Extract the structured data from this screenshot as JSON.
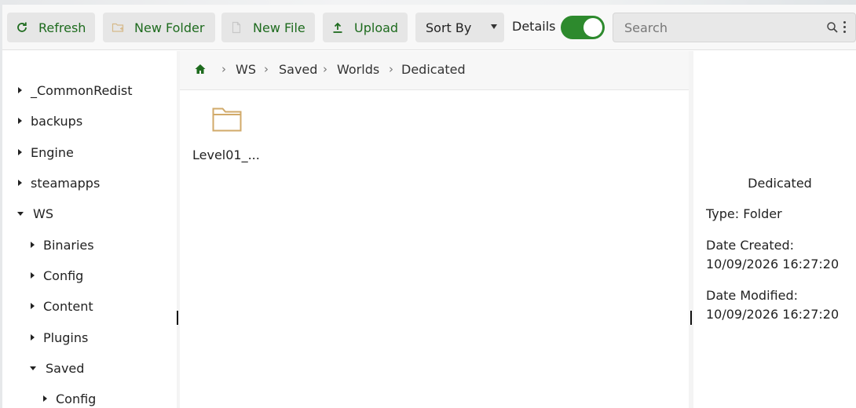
{
  "toolbar": {
    "refresh_label": "Refresh",
    "new_folder_label": "New Folder",
    "new_file_label": "New File",
    "upload_label": "Upload",
    "sort_by_label": "Sort By",
    "details_label": "Details",
    "details_toggle_on": true,
    "search_placeholder": "Search",
    "accent_color": "#2d8a2d"
  },
  "tree": {
    "items": [
      {
        "label": "_CommonRedist",
        "expanded": false
      },
      {
        "label": "backups",
        "expanded": false
      },
      {
        "label": "Engine",
        "expanded": false
      },
      {
        "label": "steamapps",
        "expanded": false
      },
      {
        "label": "WS",
        "expanded": true
      },
      {
        "label": "Binaries",
        "expanded": false
      },
      {
        "label": "Config",
        "expanded": false
      },
      {
        "label": "Content",
        "expanded": false
      },
      {
        "label": "Plugins",
        "expanded": false
      },
      {
        "label": "Saved",
        "expanded": true
      },
      {
        "label": "Config",
        "expanded": false
      }
    ]
  },
  "breadcrumb": {
    "items": [
      "WS",
      "Saved",
      "Worlds",
      "Dedicated"
    ],
    "separator": "›"
  },
  "files": [
    {
      "name": "Level01_...",
      "type": "folder",
      "icon": "folder-icon"
    }
  ],
  "details": {
    "title": "Dedicated",
    "type_line": "Type: Folder",
    "created_label": "Date Created:",
    "created_value": "10/09/2026 16:27:20",
    "modified_label": "Date Modified:",
    "modified_value": "10/09/2026 16:27:20"
  }
}
